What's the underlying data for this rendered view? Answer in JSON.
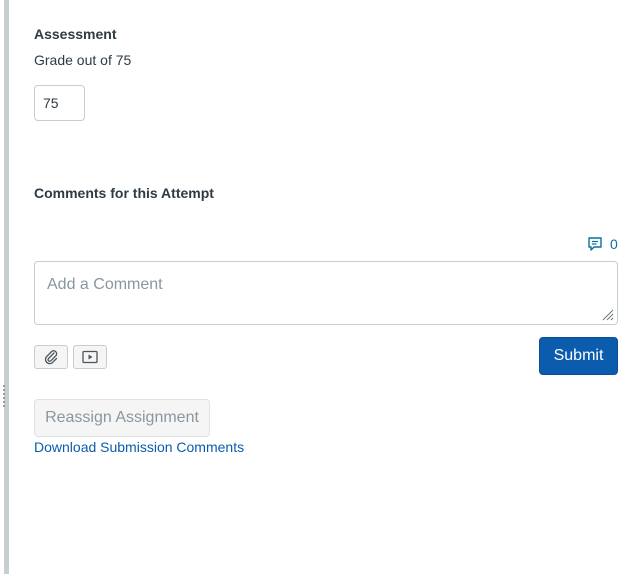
{
  "assessment": {
    "heading": "Assessment",
    "grade_label": "Grade out of 75",
    "grade_value": "75"
  },
  "comments": {
    "heading": "Comments for this Attempt",
    "count": "0",
    "placeholder": "Add a Comment",
    "attach_icon": "paperclip-icon",
    "media_icon": "media-play-icon",
    "submit_label": "Submit"
  },
  "actions": {
    "reassign_label": "Reassign Assignment",
    "download_label": "Download Submission Comments"
  },
  "colors": {
    "primary": "#0b5cad",
    "link": "#0770a3",
    "text": "#2d3b45",
    "muted": "#8b969e",
    "border": "#c7cdd1"
  }
}
